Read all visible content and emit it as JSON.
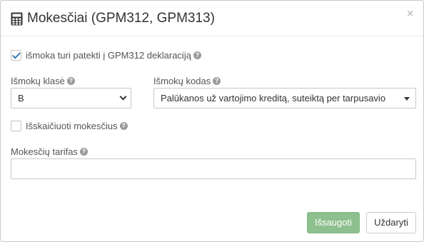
{
  "dialog": {
    "title": "Mokesčiai (GPM312, GPM313)",
    "close_glyph": "×",
    "title_icon": "calculator-icon"
  },
  "declaration_checkbox": {
    "label": "išmoka turi patekti į GPM312 deklaraciją",
    "checked": true
  },
  "payment_class": {
    "label": "Išmokų klasė",
    "value": "B"
  },
  "payment_code": {
    "label": "Išmokų kodas",
    "value": "Palūkanos už vartojimo kreditą, suteiktą per tarpusavio"
  },
  "deduct_taxes": {
    "label": "Išskaičiuoti mokesčius",
    "checked": false
  },
  "tax_rate": {
    "label": "Mokesčių tarifas",
    "value": "",
    "placeholder": ""
  },
  "buttons": {
    "save_label": "Išsaugoti",
    "close_label": "Uždaryti"
  },
  "help_glyph": "?",
  "colors": {
    "save_button": "#8ebf8e",
    "checkmark": "#337ab7",
    "border": "#c8c8c8"
  }
}
